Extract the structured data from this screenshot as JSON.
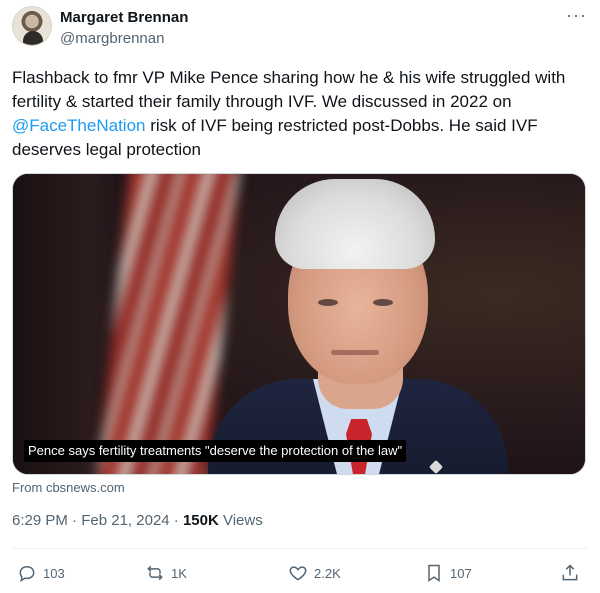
{
  "author": {
    "name": "Margaret Brennan",
    "handle": "@margbrennan"
  },
  "post": {
    "text_part1": "Flashback to fmr VP Mike Pence sharing how he & his wife struggled with fertility & started their family through IVF. We discussed in 2022 on ",
    "mention": "@FaceTheNation",
    "text_part2": " risk of IVF being restricted post-Dobbs. He said IVF deserves legal protection"
  },
  "media": {
    "caption": "Pence says fertility treatments \"deserve the protection of the law\"",
    "source": "From cbsnews.com"
  },
  "meta": {
    "time": "6:29 PM",
    "sep1": " · ",
    "date": "Feb 21, 2024",
    "sep2": " · ",
    "views_count": "150K",
    "views_label": " Views"
  },
  "actions": {
    "replies": "103",
    "reposts": "1K",
    "likes": "2.2K",
    "bookmarks": "107"
  },
  "icons": {
    "more": "more-icon",
    "reply": "reply-icon",
    "repost": "repost-icon",
    "like": "heart-icon",
    "bookmark": "bookmark-icon",
    "share": "share-icon"
  },
  "colors": {
    "accent": "#1d9bf0",
    "muted": "#536471",
    "text": "#0f1419"
  }
}
